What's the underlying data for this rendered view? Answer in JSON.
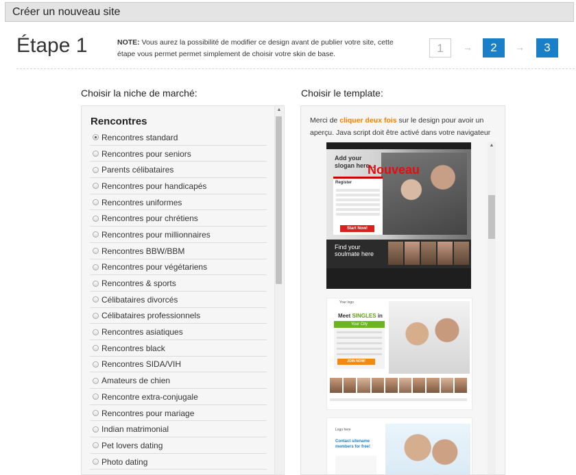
{
  "header": {
    "title": "Créer un nouveau site"
  },
  "step": {
    "title": "Étape 1",
    "note_label": "NOTE:",
    "note_text": " Vous aurez la possibilité de modifier ce design avant de publier votre site, cette étape vous permet permet simplement de choisir votre skin de base.",
    "indicators": [
      "1",
      "2",
      "3"
    ],
    "arrow": "→"
  },
  "niche": {
    "section_title": "Choisir la niche de marché:",
    "group_title": "Rencontres",
    "selected_index": 0,
    "items": [
      "Rencontres standard",
      "Rencontres pour seniors",
      "Parents célibataires",
      "Rencontres pour handicapés",
      "Rencontres uniformes",
      "Rencontres pour chrétiens",
      "Rencontres pour millionnaires",
      "Rencontres BBW/BBM",
      "Rencontres pour végétariens",
      "Rencontres & sports",
      "Célibataires divorcés",
      "Célibataires professionnels",
      "Rencontres asiatiques",
      "Rencontres black",
      "Rencontres SIDA/VIH",
      "Amateurs de chien",
      "Rencontre extra-conjugale",
      "Rencontres pour mariage",
      "Indian matrimonial",
      "Pet lovers dating",
      "Photo dating"
    ]
  },
  "template": {
    "section_title": "Choisir le template:",
    "intro_before": "Merci de ",
    "intro_highlight": "cliquer deux fois",
    "intro_after": " sur le design pour avoir un aperçu. Java script doit être activé dans votre navigateur",
    "thumb1": {
      "slogan": "Add your slogan here...",
      "badge": "Nouveau",
      "register": "Register",
      "start": "Start Now!",
      "find": "Find your soulmate here"
    },
    "thumb2": {
      "logo": "Your logo",
      "meet": "Meet",
      "singles": "SINGLES",
      "in": " in",
      "city": "Your City",
      "join": "JOIN NOW!"
    },
    "thumb3": {
      "logo": "Logo here",
      "contact": "Contact sitename members for free!"
    }
  },
  "colors": {
    "accent": "#1a7fc9",
    "highlight": "#f57e00",
    "nouveau": "#e01010"
  }
}
